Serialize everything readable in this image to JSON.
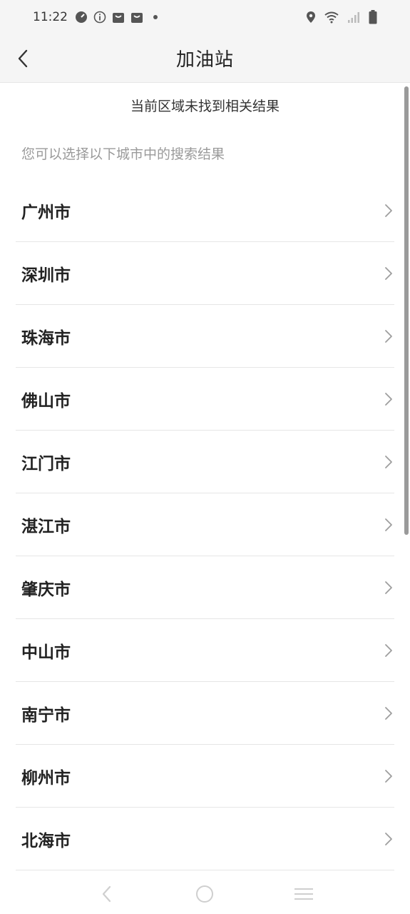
{
  "status_bar": {
    "time": "11:22",
    "icons_left": [
      "speedometer-icon",
      "info-icon",
      "bag-icon",
      "bag-icon",
      "dot-icon"
    ],
    "icons_right": [
      "location-icon",
      "wifi-icon",
      "signal-icon",
      "battery-icon"
    ]
  },
  "header": {
    "title": "加油站"
  },
  "notice": "当前区域未找到相关结果",
  "hint": "您可以选择以下城市中的搜索结果",
  "cities": [
    {
      "name": "广州市"
    },
    {
      "name": "深圳市"
    },
    {
      "name": "珠海市"
    },
    {
      "name": "佛山市"
    },
    {
      "name": "江门市"
    },
    {
      "name": "湛江市"
    },
    {
      "name": "肇庆市"
    },
    {
      "name": "中山市"
    },
    {
      "name": "南宁市"
    },
    {
      "name": "柳州市"
    },
    {
      "name": "北海市"
    }
  ],
  "colors": {
    "header_bg": "#f5f5f5",
    "divider": "#e6e6e6",
    "hint_text": "#9a9a9a",
    "primary_text": "#222222"
  }
}
